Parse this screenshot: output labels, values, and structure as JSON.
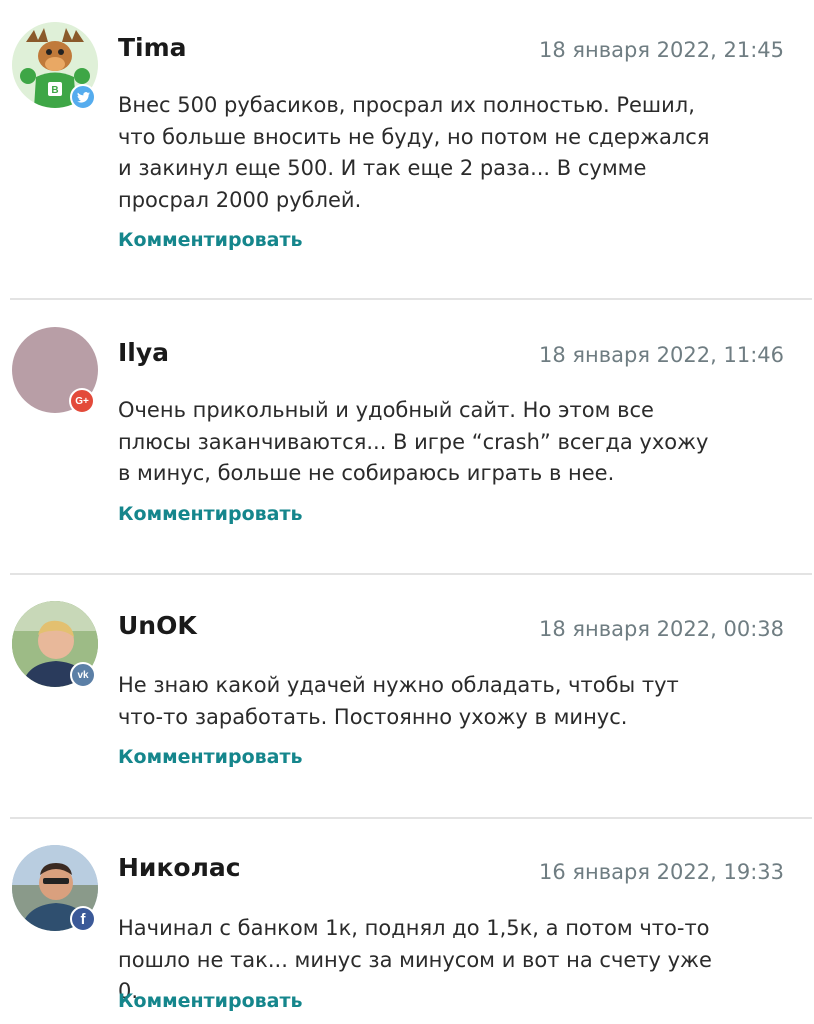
{
  "comments": [
    {
      "author": "Tima",
      "date": "18 января 2022, 21:45",
      "text": "Внес 500 рубасиков, просрал их полностью. Решил, что больше вносить не буду, но потом не сдержался и закинул еще 500. И так еще 2 раза... В сумме просрал 2000 рублей.",
      "reply_label": "Комментировать",
      "network_icon": "twitter-icon",
      "network_color": "#55acee"
    },
    {
      "author": "Ilya",
      "date": "18 января 2022, 11:46",
      "text": "Очень прикольный и удобный сайт. Но этом все плюсы заканчиваются... В игре “crash” всегда ухожу в минус, больше не собираюсь играть в нее.",
      "reply_label": "Комментировать",
      "network_icon": "google-plus-icon",
      "network_label": "G+",
      "network_color": "#e34a3a",
      "avatar_color": "#b89ea6"
    },
    {
      "author": "UnOK",
      "date": "18 января 2022, 00:38",
      "text": "Не знаю какой удачей нужно обладать, чтобы тут что-то заработать. Постоянно ухожу в минус.",
      "reply_label": "Комментировать",
      "network_icon": "vk-icon",
      "network_label": "vk",
      "network_color": "#5b7fa6"
    },
    {
      "author": "Николас",
      "date": "16 января 2022, 19:33",
      "text": "Начинал с банком 1к, поднял до 1,5к, а потом что-то пошло не так... минус за минусом и вот на счету уже 0.",
      "reply_label": "Комментировать",
      "network_icon": "facebook-icon",
      "network_label": "f",
      "network_color": "#3b5998"
    }
  ],
  "colors": {
    "accent": "#15868c",
    "date": "#6f7d82",
    "divider": "#e3e3e3"
  }
}
